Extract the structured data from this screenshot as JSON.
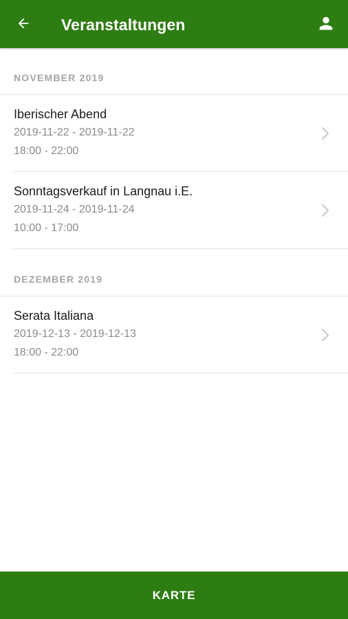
{
  "header": {
    "title": "Veranstaltungen",
    "back_icon": "arrow-left-icon",
    "profile_icon": "person-icon"
  },
  "colors": {
    "primary": "#2e7d12",
    "section_text": "#a5a5a5",
    "secondary_text": "#8a8a8a",
    "divider": "#e3e3e3"
  },
  "sections": [
    {
      "title": "NOVEMBER 2019",
      "events": [
        {
          "title": "Iberischer Abend",
          "dates": "2019-11-22 - 2019-11-22",
          "time": "18:00 - 22:00"
        },
        {
          "title": "Sonntagsverkauf in Langnau i.E.",
          "dates": "2019-11-24 - 2019-11-24",
          "time": "10:00 - 17:00"
        }
      ]
    },
    {
      "title": "DEZEMBER 2019",
      "events": [
        {
          "title": "Serata Italiana",
          "dates": "2019-12-13 - 2019-12-13",
          "time": "18:00 - 22:00"
        }
      ]
    }
  ],
  "bottom_bar": {
    "label": "KARTE"
  }
}
